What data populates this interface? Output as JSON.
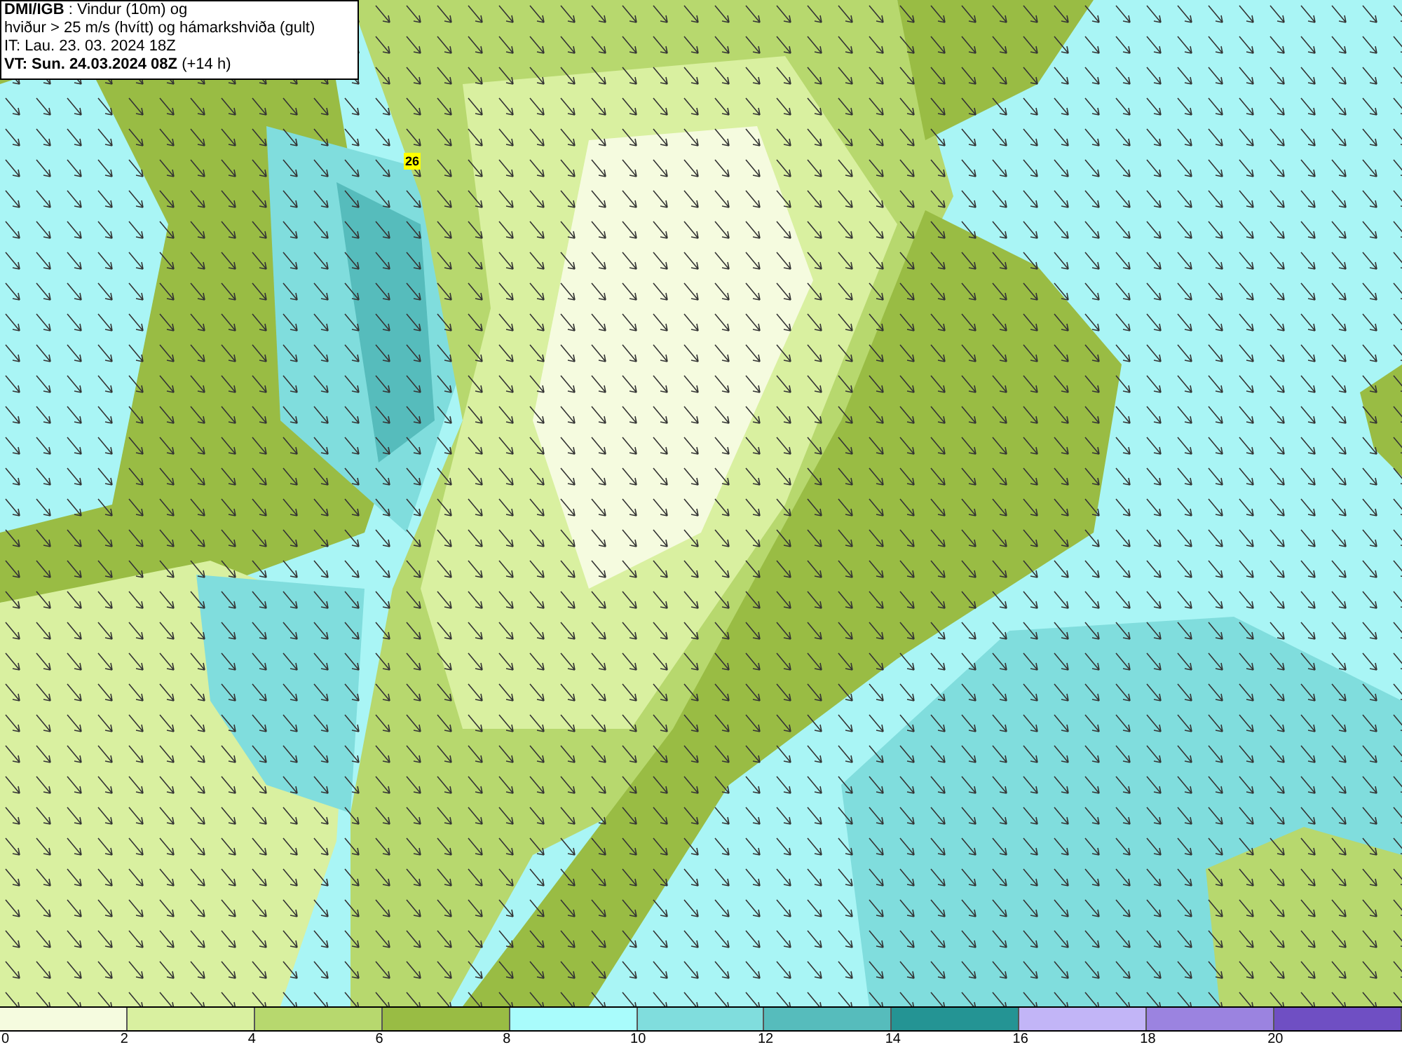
{
  "header": {
    "line1": "**DMI/IGB** : Vindur (10m) og",
    "line2": "hviður > 25 m/s (hvítt) og hámarkshviða (gult)",
    "line3": "IT: Lau. 23. 03. 2024 18Z",
    "line4": "**VT: Sun. 24.03.2024 08Z** (+14 h)"
  },
  "map": {
    "gust_labels": [
      "26"
    ]
  },
  "legend": {
    "segments": [
      {
        "color": "#f5fbdf"
      },
      {
        "color": "#d9f0a0"
      },
      {
        "color": "#b7d86e"
      },
      {
        "color": "#99bc44"
      },
      {
        "color": "#a9fcfc"
      },
      {
        "color": "#80dddd"
      },
      {
        "color": "#56bcbc"
      },
      {
        "color": "#249494"
      },
      {
        "color": "#c2b5f7"
      },
      {
        "color": "#9b83e0"
      },
      {
        "color": "#6f4fc3"
      }
    ],
    "ticks": [
      "0",
      "2",
      "4",
      "6",
      "8",
      "10",
      "12",
      "14",
      "16",
      "18",
      "20"
    ]
  }
}
